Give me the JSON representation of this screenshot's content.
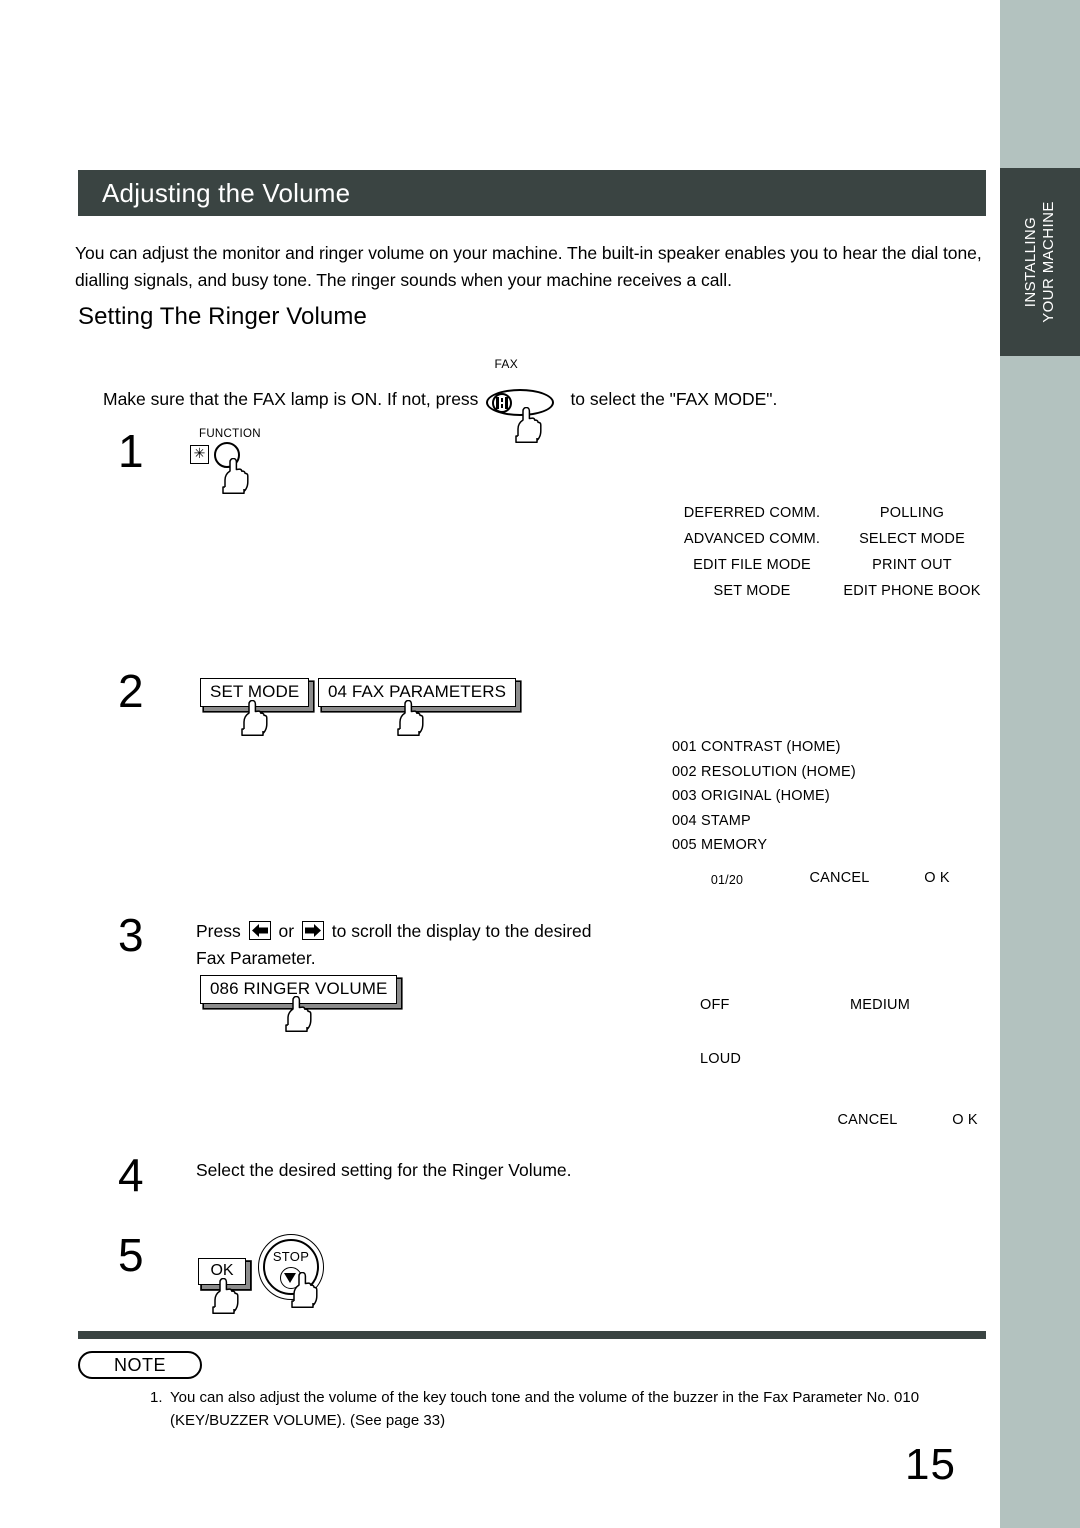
{
  "side_tab": {
    "line1": "INSTALLING",
    "line2": "YOUR MACHINE"
  },
  "header": {
    "title": "Adjusting the Volume",
    "bar_color": "#3a4442"
  },
  "intro": {
    "paragraph": "You can adjust the monitor and ringer volume on your machine. The built-in speaker enables you to hear the dial tone, dialling signals, and busy tone. The ringer sounds when your machine receives a call."
  },
  "sub_heading": "Setting The Ringer Volume",
  "fax_line": {
    "text_before": "Make sure that the FAX lamp is ON.  If not, press",
    "key_label": "FAX",
    "text_after": "to select the \"FAX MODE\"."
  },
  "steps": [
    {
      "number": "1",
      "key_label": "FUNCTION",
      "key_star": "✳"
    },
    {
      "number": "2",
      "buttons": [
        {
          "label": "SET MODE"
        },
        {
          "label": "04 FAX PARAMETERS"
        }
      ]
    },
    {
      "number": "3",
      "text_line1_a": "Press",
      "text_line1_b": "or",
      "text_line1_c": "to scroll the display to the desired",
      "text_line2": "Fax Parameter.",
      "button": {
        "label": "086 RINGER VOLUME"
      },
      "arrow_left": "left-arrow-icon",
      "arrow_right": "right-arrow-icon"
    },
    {
      "number": "4",
      "text": "Select the desired setting for the Ringer Volume."
    },
    {
      "number": "5",
      "ok_label": "OK",
      "stop_label": "STOP"
    }
  ],
  "displays": {
    "menu": {
      "rows": [
        {
          "left": "DEFERRED COMM.",
          "right": "POLLING"
        },
        {
          "left": "ADVANCED COMM.",
          "right": "SELECT MODE"
        },
        {
          "left": "EDIT FILE MODE",
          "right": "PRINT OUT"
        },
        {
          "left": "SET MODE",
          "right": "EDIT PHONE BOOK"
        }
      ]
    },
    "parameters": {
      "items": [
        "001 CONTRAST (HOME)",
        "002 RESOLUTION (HOME)",
        "003 ORIGINAL (HOME)",
        "004 STAMP",
        "005 MEMORY"
      ],
      "footer": {
        "page": "01/20",
        "cancel": "CANCEL",
        "ok": "O K"
      }
    },
    "ringer": {
      "rows": [
        {
          "left": "OFF",
          "right": "MEDIUM"
        },
        {
          "left": "LOUD",
          "right": ""
        }
      ],
      "footer": {
        "page": "",
        "cancel": "CANCEL",
        "ok": "O K"
      }
    }
  },
  "note": {
    "badge": "NOTE",
    "items": [
      {
        "num": "1.",
        "line1": "You can also adjust the volume of the key touch tone and the volume of the buzzer in the Fax Parameter No. 010",
        "line2": "(KEY/BUZZER VOLUME).  (See page 33)"
      }
    ]
  },
  "page_number": "15"
}
